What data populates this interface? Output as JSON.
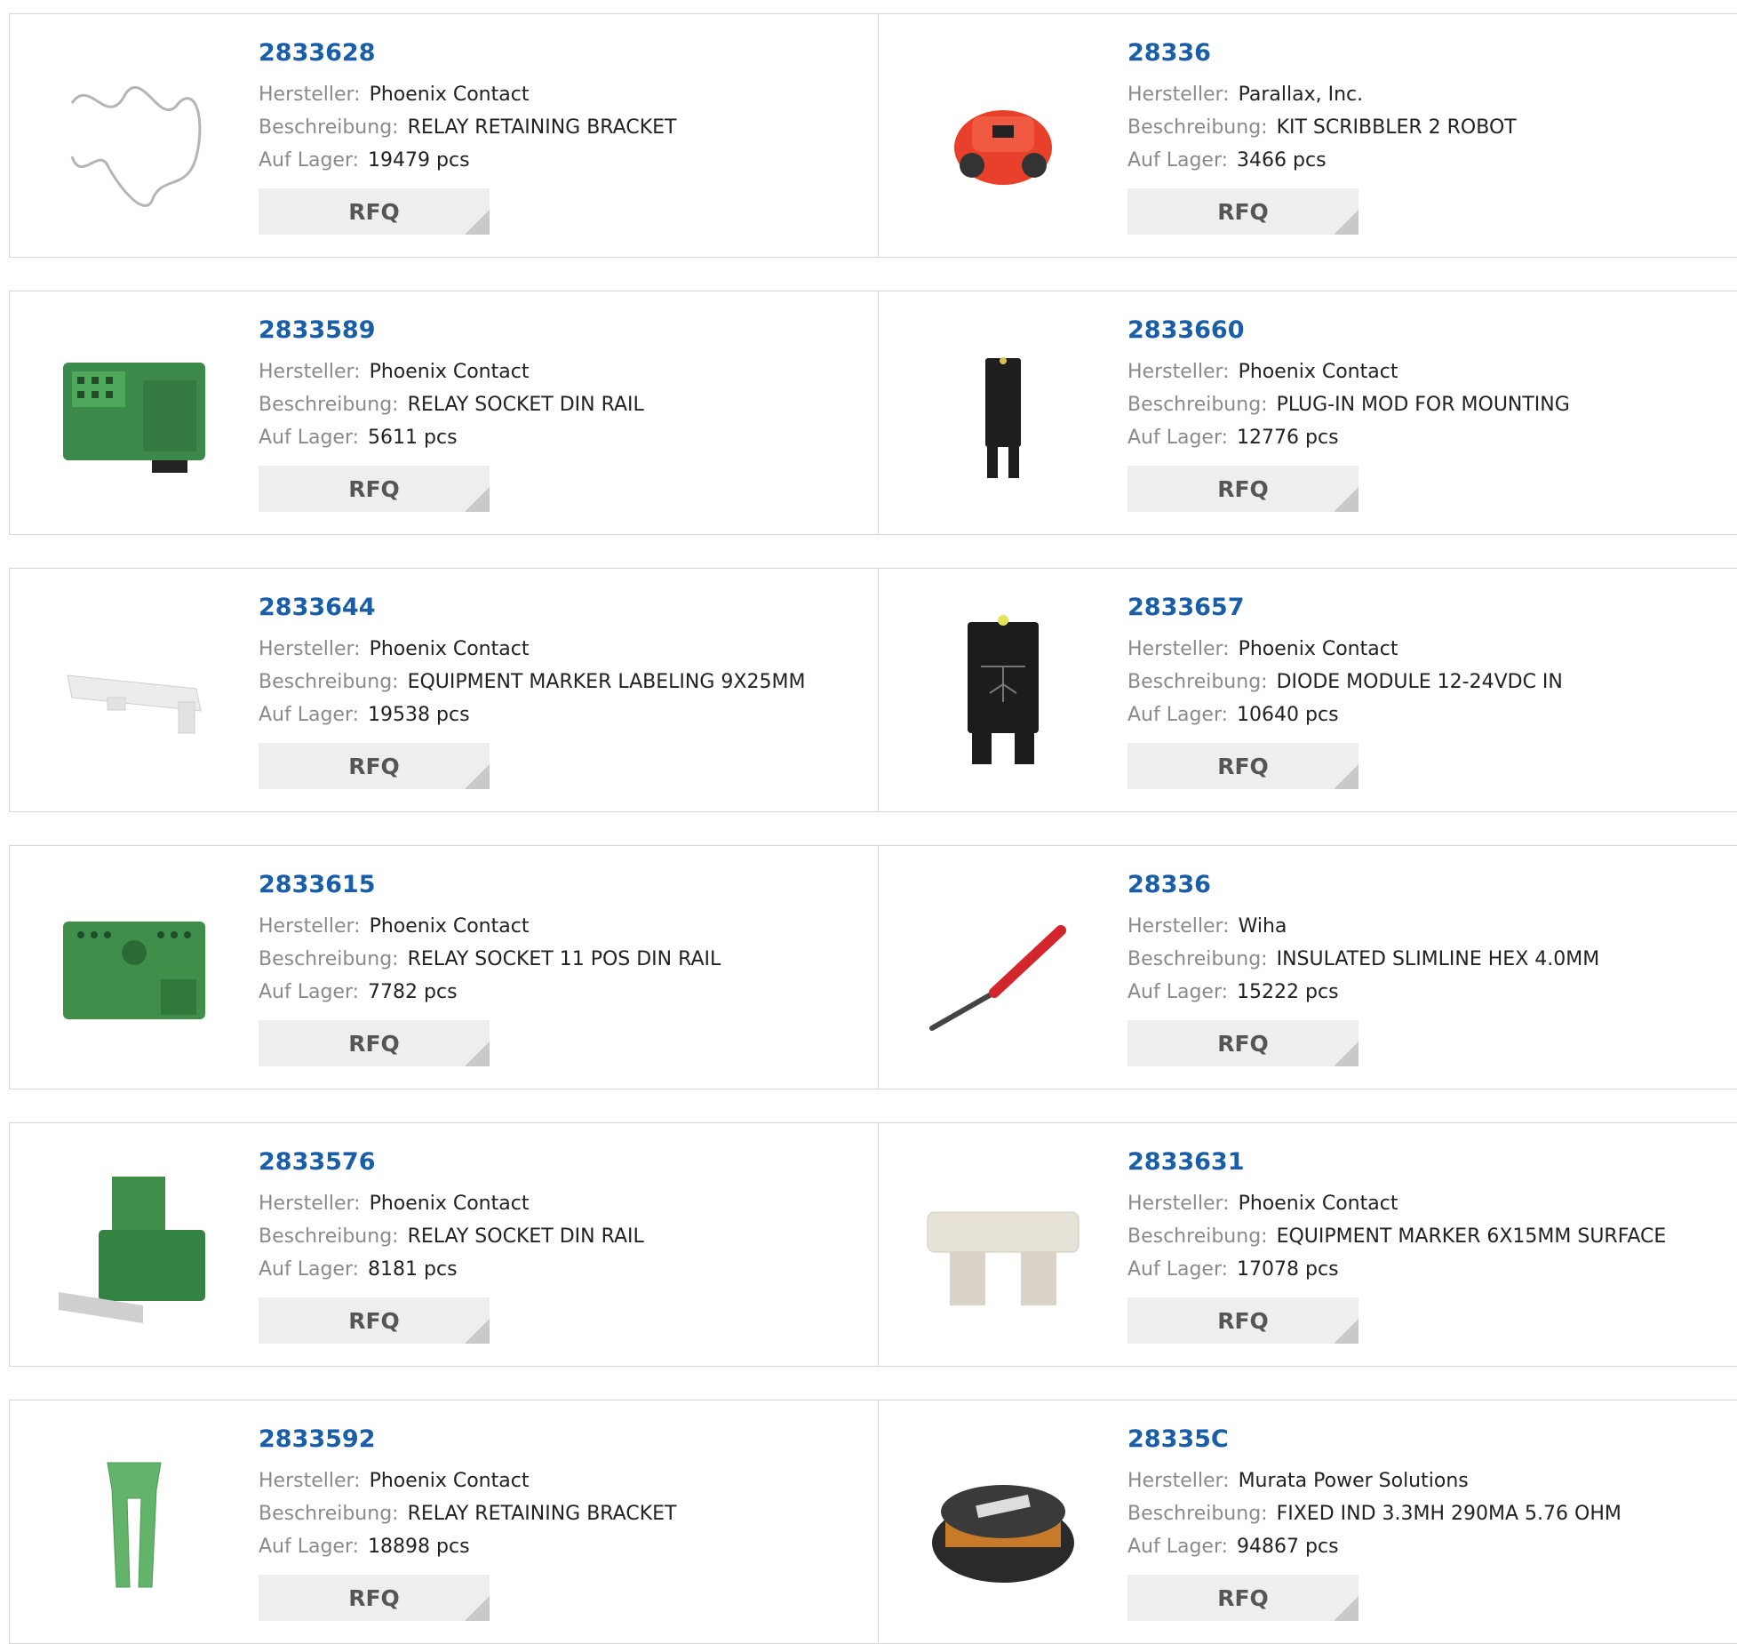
{
  "labels": {
    "manufacturer": "Hersteller:",
    "description": "Beschreibung:",
    "stock": "Auf Lager:",
    "rfq": "RFQ"
  },
  "colors": {
    "part_link": "#1a5ea8",
    "label": "#8a8a8a",
    "button_bg": "#eeeeee"
  },
  "products": [
    {
      "part": "2833628",
      "manufacturer": "Phoenix Contact",
      "description": "RELAY RETAINING BRACKET",
      "stock": "19479 pcs",
      "image": "wire-bracket-image"
    },
    {
      "part": "28336",
      "manufacturer": "Parallax, Inc.",
      "description": "KIT SCRIBBLER 2 ROBOT",
      "stock": "3466 pcs",
      "image": "red-robot-image"
    },
    {
      "part": "2833589",
      "manufacturer": "Phoenix Contact",
      "description": "RELAY SOCKET DIN RAIL",
      "stock": "5611 pcs",
      "image": "green-relay-socket-image"
    },
    {
      "part": "2833660",
      "manufacturer": "Phoenix Contact",
      "description": "PLUG-IN MOD FOR MOUNTING",
      "stock": "12776 pcs",
      "image": "black-plugin-module-image"
    },
    {
      "part": "2833644",
      "manufacturer": "Phoenix Contact",
      "description": "EQUIPMENT MARKER LABELING 9X25MM",
      "stock": "19538 pcs",
      "image": "white-marker-image"
    },
    {
      "part": "2833657",
      "manufacturer": "Phoenix Contact",
      "description": "DIODE MODULE 12-24VDC IN",
      "stock": "10640 pcs",
      "image": "diode-module-image"
    },
    {
      "part": "2833615",
      "manufacturer": "Phoenix Contact",
      "description": "RELAY SOCKET 11 POS DIN RAIL",
      "stock": "7782 pcs",
      "image": "green-socket-11pos-image"
    },
    {
      "part": "28336",
      "manufacturer": "Wiha",
      "description": "INSULATED SLIMLINE HEX 4.0MM",
      "stock": "15222 pcs",
      "image": "red-hex-bit-image"
    },
    {
      "part": "2833576",
      "manufacturer": "Phoenix Contact",
      "description": "RELAY SOCKET DIN RAIL",
      "stock": "8181 pcs",
      "image": "green-socket-with-marker-image"
    },
    {
      "part": "2833631",
      "manufacturer": "Phoenix Contact",
      "description": "EQUIPMENT MARKER 6X15MM SURFACE",
      "stock": "17078 pcs",
      "image": "beige-marker-image"
    },
    {
      "part": "2833592",
      "manufacturer": "Phoenix Contact",
      "description": "RELAY RETAINING BRACKET",
      "stock": "18898 pcs",
      "image": "green-bracket-image"
    },
    {
      "part": "28335C",
      "manufacturer": "Murata Power Solutions",
      "description": "FIXED IND 3.3MH 290MA 5.76 OHM",
      "stock": "94867 pcs",
      "image": "inductor-image"
    }
  ]
}
